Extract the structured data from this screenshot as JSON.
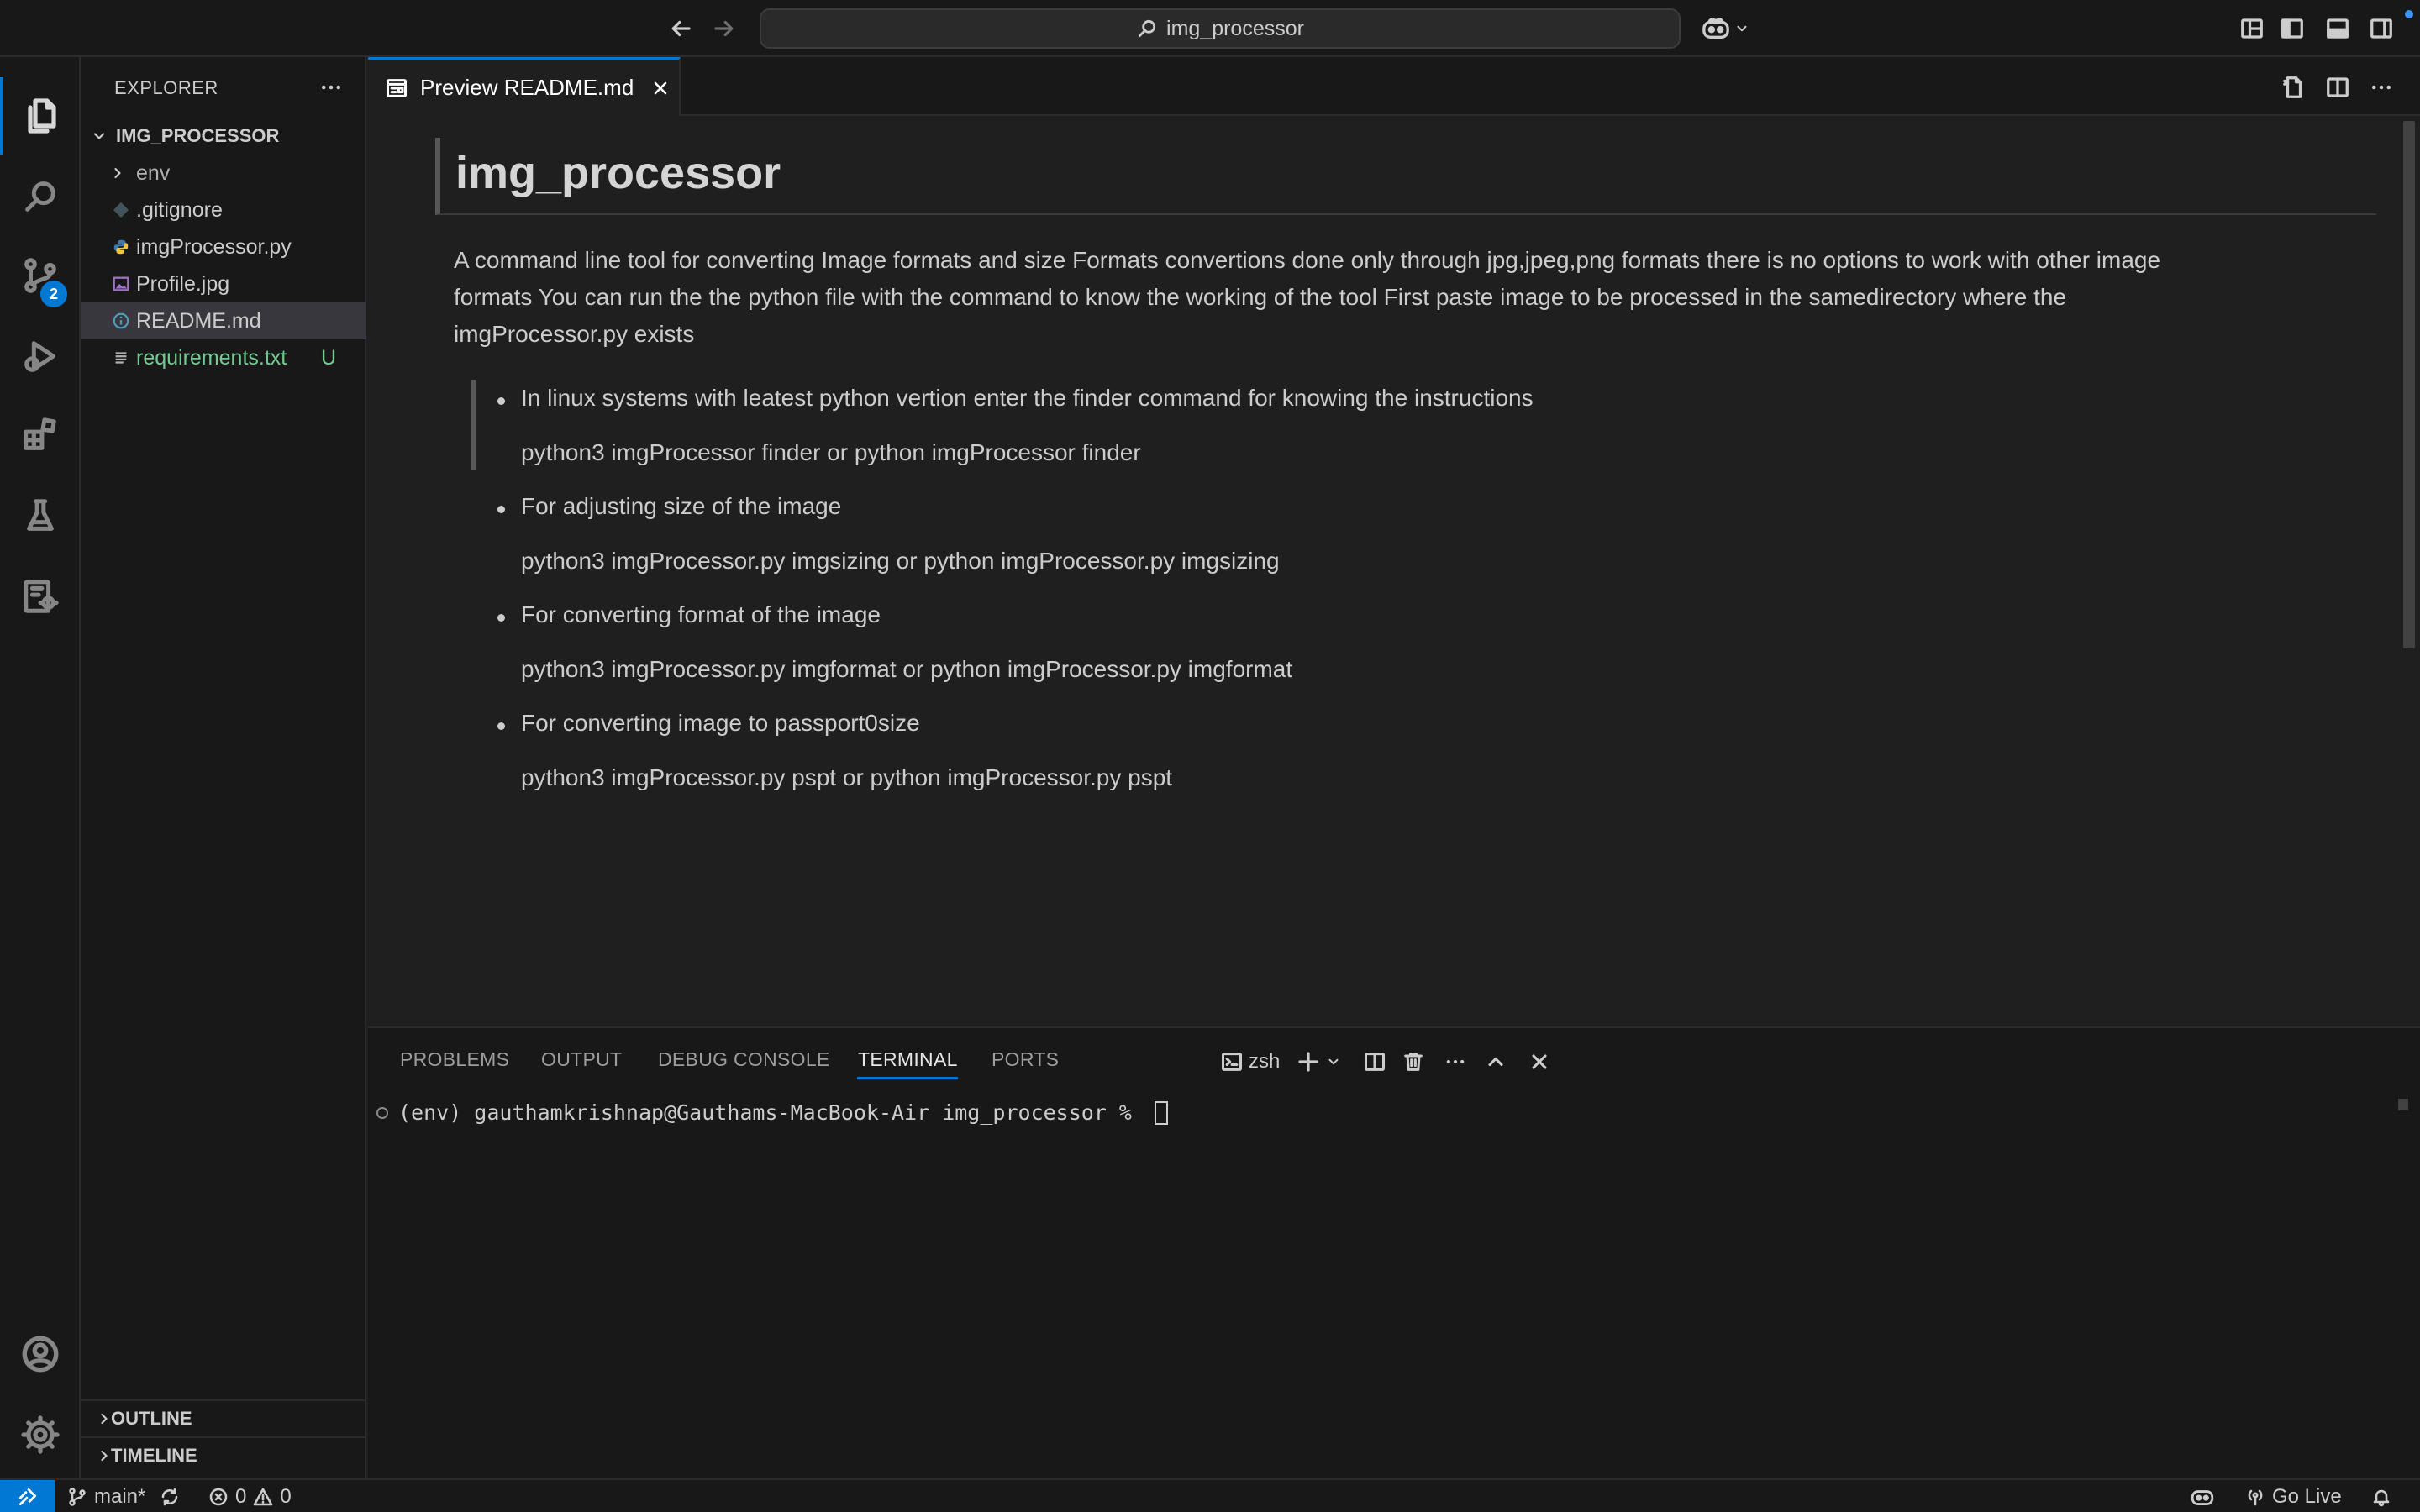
{
  "titlebar": {
    "search_text": "img_processor"
  },
  "activity": {
    "scm_badge": "2"
  },
  "sidebar": {
    "title": "EXPLORER",
    "folder": "IMG_PROCESSOR",
    "items": [
      {
        "label": "env",
        "kind": "folder"
      },
      {
        "label": ".gitignore",
        "kind": "git"
      },
      {
        "label": "imgProcessor.py",
        "kind": "python"
      },
      {
        "label": "Profile.jpg",
        "kind": "image"
      },
      {
        "label": "README.md",
        "kind": "info"
      },
      {
        "label": "requirements.txt",
        "kind": "text",
        "badge": "U"
      }
    ],
    "outline": "OUTLINE",
    "timeline": "TIMELINE"
  },
  "editor": {
    "tab_label": "Preview README.md"
  },
  "readme": {
    "h1": "img_processor",
    "para_lines": [
      "A command line tool for converting Image formats and size Formats convertions done only through jpg,jpeg,png formats there is no options to work with other image",
      "formats You can run the the python file with the command to know the working of the tool First paste image to be processed in the samedirectory where the",
      "imgProcessor.py exists"
    ],
    "items": [
      {
        "text": "In linux systems with leatest python vertion enter the finder command for knowing the instructions",
        "cmd": "python3 imgProcessor finder or python imgProcessor finder"
      },
      {
        "text": "For adjusting size of the image",
        "cmd": "python3 imgProcessor.py imgsizing or python imgProcessor.py imgsizing"
      },
      {
        "text": "For converting format of the image",
        "cmd": "python3 imgProcessor.py imgformat or python imgProcessor.py imgformat"
      },
      {
        "text": "For converting image to passport0size",
        "cmd": "python3 imgProcessor.py pspt or python imgProcessor.py pspt"
      }
    ]
  },
  "panel": {
    "tabs": [
      "PROBLEMS",
      "OUTPUT",
      "DEBUG CONSOLE",
      "TERMINAL",
      "PORTS"
    ],
    "active_tab": "TERMINAL",
    "shell": "zsh",
    "terminal_line": "(env) gauthamkrishnap@Gauthams-MacBook-Air img_processor % "
  },
  "statusbar": {
    "branch": "main*",
    "errors": "0",
    "warnings": "0",
    "go_live": "Go Live"
  },
  "colors": {
    "accent": "#0078d4",
    "untracked": "#73c991"
  }
}
